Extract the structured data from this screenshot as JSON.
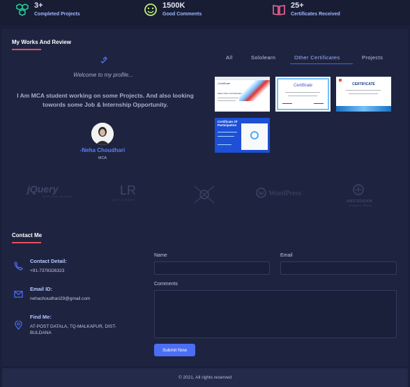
{
  "stats": [
    {
      "value": "3+",
      "label": "Completed Projects",
      "icon": "cubes-icon",
      "color": "#20c997"
    },
    {
      "value": "1500K",
      "label": "Good Comments",
      "icon": "smile-icon",
      "color": "#c0eb75"
    },
    {
      "value": "25+",
      "label": "Certificates Received",
      "icon": "book-icon",
      "color": "#f06595"
    }
  ],
  "works": {
    "title": "My Works And Review",
    "welcome": "Welcome to my profile...",
    "bio": "I Am MCA student working on some Projects. And also looking towords some Job & Internship Opportunity.",
    "name": "-Neha Choudhari",
    "role": "MCA",
    "tabs": [
      "All",
      "Sololearn",
      "Other Certificates",
      "Projects"
    ],
    "active_tab": "Other Certificates",
    "certificates": [
      {
        "heading": "Certificate",
        "caption": "NEHA ANIL CHOUDHARI"
      },
      {
        "heading": "Certificate",
        "caption": ""
      },
      {
        "heading": "CERTIFICATE",
        "caption": ""
      },
      {
        "heading": "Certificate Of Participation",
        "caption": ""
      }
    ],
    "logos": [
      {
        "name": "jQuery",
        "sub": "write less, do more."
      },
      {
        "name": "LR",
        "sub": "LEFT & RIGHT"
      },
      {
        "name": "",
        "sub": ""
      },
      {
        "name": "WordPress",
        "sub": ""
      },
      {
        "name": "AMSTERDAM",
        "sub": "Creative Works"
      }
    ]
  },
  "contact": {
    "title": "Contact Me",
    "detail_title": "Contact Detail:",
    "detail_value": "+91-7378326323",
    "email_title": "Email ID:",
    "email_value": "nehachoudhari29@gmail.com",
    "find_title": "Find Me:",
    "find_value": "AT-POST DATALA, TQ-MALKAPUR, DIST-BULDANA",
    "form": {
      "name_label": "Name",
      "email_label": "Email",
      "comments_label": "Comments",
      "submit_label": "Submit Now"
    }
  },
  "footer": {
    "text": "© 2021, All rights reserved"
  }
}
